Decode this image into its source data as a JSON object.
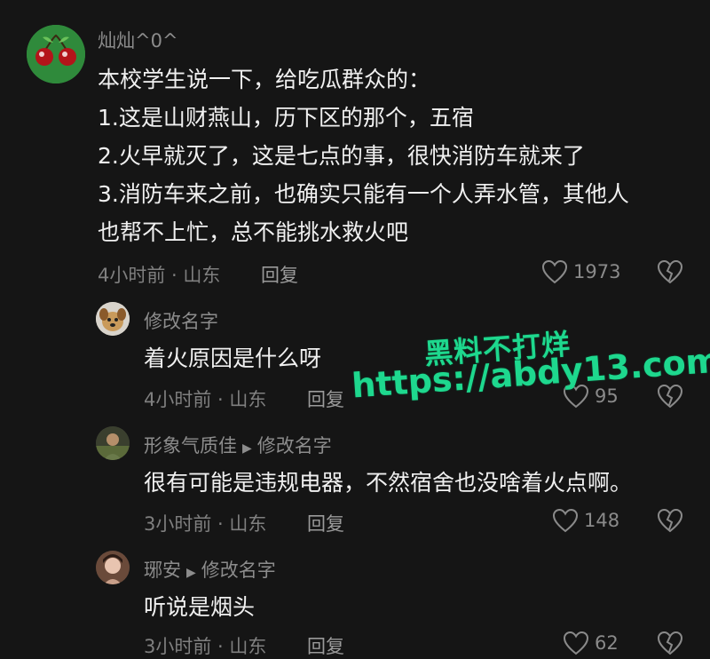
{
  "comments": [
    {
      "username": "灿灿^0^",
      "lines": [
        "本校学生说一下，给吃瓜群众的：",
        "1.这是山财燕山，历下区的那个，五宿",
        "2.火早就灭了，这是七点的事，很快消防车就来了",
        "3.消防车来之前，也确实只能有一个人弄水管，其他人",
        "也帮不上忙，总不能挑水救火吧"
      ],
      "time_location": "4小时前 · 山东",
      "reply_label": "回复",
      "likes": "1973",
      "avatar_icon": "cherries-icon"
    }
  ],
  "replies": [
    {
      "username": "修改名字",
      "reply_to": "",
      "text": "着火原因是什么呀",
      "time_location": "4小时前 · 山东",
      "reply_label": "回复",
      "likes": "95",
      "avatar_icon": "dog-avatar"
    },
    {
      "username": "形象气质佳",
      "reply_to": "修改名字",
      "text": "很有可能是违规电器，不然宿舍也没啥着火点啊。",
      "time_location": "3小时前 · 山东",
      "reply_label": "回复",
      "likes": "148",
      "avatar_icon": "person-avatar"
    },
    {
      "username": "琊安",
      "reply_to": "修改名字",
      "text": "听说是烟头",
      "time_location": "3小时前 · 山东",
      "reply_label": "回复",
      "likes": "62",
      "avatar_icon": "girl-avatar"
    }
  ],
  "watermark": {
    "line1": "黑料不打烊",
    "line2": "https://abdy13.com",
    "color": "#1ed88e"
  },
  "colors": {
    "background": "#151515",
    "text": "#f0f0f0",
    "muted": "#8c8c8c"
  }
}
